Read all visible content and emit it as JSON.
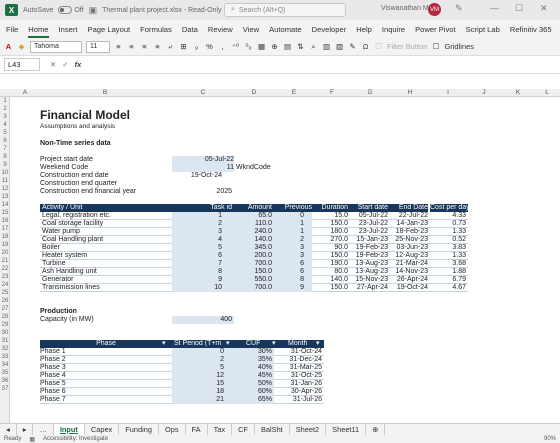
{
  "titlebar": {
    "autosave_label": "AutoSave",
    "autosave_state": "Off",
    "file_title": "Thermal plant project.xlsx - Read-Only",
    "search_placeholder": "Search (Alt+Q)",
    "user_name": "Viswanathan M S",
    "avatar_initials": "VM"
  },
  "menu": {
    "items": [
      "File",
      "Home",
      "Insert",
      "Page Layout",
      "Formulas",
      "Data",
      "Review",
      "View",
      "Automate",
      "Developer",
      "Help",
      "Inquire",
      "Power Pivot",
      "Script Lab",
      "Refinitiv 365"
    ]
  },
  "ribbon": {
    "font_name": "Tahoma",
    "font_size": "11",
    "number_format_sample": "%",
    "filter_label": "Filter Button",
    "gridlines_label": "Gridlines"
  },
  "formula_bar": {
    "name_box": "L43",
    "fx_label": "fx",
    "formula": ""
  },
  "columns": [
    "A",
    "B",
    "C",
    "D",
    "E",
    "F",
    "G",
    "H",
    "I",
    "J",
    "K",
    "L"
  ],
  "rows": [
    "1",
    "2",
    "3",
    "4",
    "5",
    "6",
    "7",
    "8",
    "9",
    "10",
    "11",
    "12",
    "13",
    "14",
    "15",
    "16",
    "17",
    "18",
    "19",
    "20",
    "21",
    "22",
    "23",
    "24",
    "25",
    "26",
    "27",
    "28",
    "29",
    "30",
    "31",
    "32",
    "33",
    "34",
    "35",
    "36",
    "37"
  ],
  "sheet": {
    "title": "Financial Model",
    "subtitle": "Assumptions and analysis",
    "section1": "Non-Time series data",
    "fields": [
      {
        "label": "Project start date",
        "value": "05-Jul-22"
      },
      {
        "label": "Weekend Code",
        "value": "11",
        "extra": "WkndCode"
      },
      {
        "label": "Construction end date",
        "value": "19-Oct-24"
      },
      {
        "label": "Construction end quarter",
        "value": ""
      },
      {
        "label": "Construction end financial year",
        "value": "2025"
      }
    ],
    "task_headers": [
      "Activity / Unit",
      "Task id",
      "Amount",
      "Previous",
      "Duration",
      "Start date",
      "End Date",
      "Cost per day"
    ],
    "tasks": [
      [
        "Legal, registration etc.",
        "1",
        "65.0",
        "0",
        "15.0",
        "05-Jul-22",
        "22-Jul-22",
        "4.33"
      ],
      [
        "Coal storage facility",
        "2",
        "110.0",
        "1",
        "150.0",
        "23-Jul-22",
        "14-Jan-23",
        "0.73"
      ],
      [
        "Water pump",
        "3",
        "240.0",
        "1",
        "180.0",
        "23-Jul-22",
        "18-Feb-23",
        "1.33"
      ],
      [
        "Coal Handling plant",
        "4",
        "140.0",
        "2",
        "270.0",
        "15-Jan-23",
        "25-Nov-23",
        "0.52"
      ],
      [
        "Boiler",
        "5",
        "345.0",
        "3",
        "90.0",
        "19-Feb-23",
        "03-Jun-23",
        "3.83"
      ],
      [
        "Heater system",
        "6",
        "200.0",
        "3",
        "150.0",
        "19-Feb-23",
        "12-Aug-23",
        "1.33"
      ],
      [
        "Turbine",
        "7",
        "700.0",
        "6",
        "190.0",
        "13-Aug-23",
        "21-Mar-24",
        "3.68"
      ],
      [
        "Ash Handling unit",
        "8",
        "150.0",
        "6",
        "80.0",
        "13-Aug-23",
        "14-Nov-23",
        "1.88"
      ],
      [
        "Generator",
        "9",
        "550.0",
        "8",
        "140.0",
        "15-Nov-23",
        "26-Apr-24",
        "6.79"
      ],
      [
        "Transmission lines",
        "10",
        "700.0",
        "9",
        "150.0",
        "27-Apr-24",
        "19-Oct-24",
        "4.67"
      ]
    ],
    "section2": "Production",
    "capacity_label": "Capacity (in MW)",
    "capacity_value": "400",
    "phase_headers": [
      "Phase",
      "St Period (T+m",
      "CUF",
      "Month"
    ],
    "phases": [
      [
        "Phase 1",
        "0",
        "30%",
        "31-Oct-24"
      ],
      [
        "Phase 2",
        "2",
        "35%",
        "31-Dec-24"
      ],
      [
        "Phase 3",
        "5",
        "40%",
        "31-Mar-25"
      ],
      [
        "Phase 4",
        "12",
        "45%",
        "31-Oct-25"
      ],
      [
        "Phase 5",
        "15",
        "50%",
        "31-Jan-26"
      ],
      [
        "Phase 6",
        "18",
        "60%",
        "30-Apr-26"
      ],
      [
        "Phase 7",
        "21",
        "65%",
        "31-Jul-26"
      ]
    ]
  },
  "tabs": [
    "Input",
    "Capex",
    "Funding",
    "Ops",
    "FA",
    "Tax",
    "CF",
    "BalSht",
    "Sheet2",
    "Sheet11"
  ],
  "active_tab": "Input",
  "status": {
    "ready": "Ready",
    "accessibility": "Accessibility: Investigate",
    "zoom": "90%"
  },
  "colors": {
    "excel_green": "#1d6f42",
    "header_navy": "#16365c",
    "input_blue": "#dce6f1"
  }
}
